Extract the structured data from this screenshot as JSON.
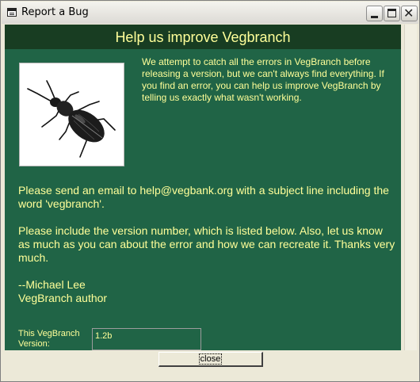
{
  "window": {
    "title": "Report a Bug",
    "icon": "form-icon",
    "controls": {
      "minimize": "minimize-icon",
      "maximize": "maximize-icon",
      "close": "close-x-icon"
    }
  },
  "form": {
    "header": "Help us improve Vegbranch",
    "intro": "We attempt to catch all the errors in VegBranch before releasing a version, but we can't always find everything.  If you find an error, you can help us improve VegBranch by telling us exactly what wasn't working.",
    "email_paragraph": "Please send an email to help@vegbank.org with a subject line including the word 'vegbranch'.",
    "version_paragraph": "Please include the version number, which is listed below.  Also, let us know as much as you can about the error and how we can recreate it.  Thanks very much.",
    "signature_name": "--Michael Lee",
    "signature_role": "VegBranch author",
    "version_label": "This VegBranch Version:",
    "version_value": "1.2b",
    "close_label": "close",
    "image": "beetle-illustration",
    "colors": {
      "background": "#206446",
      "header_band": "#183d22",
      "text": "#ffff99"
    }
  }
}
